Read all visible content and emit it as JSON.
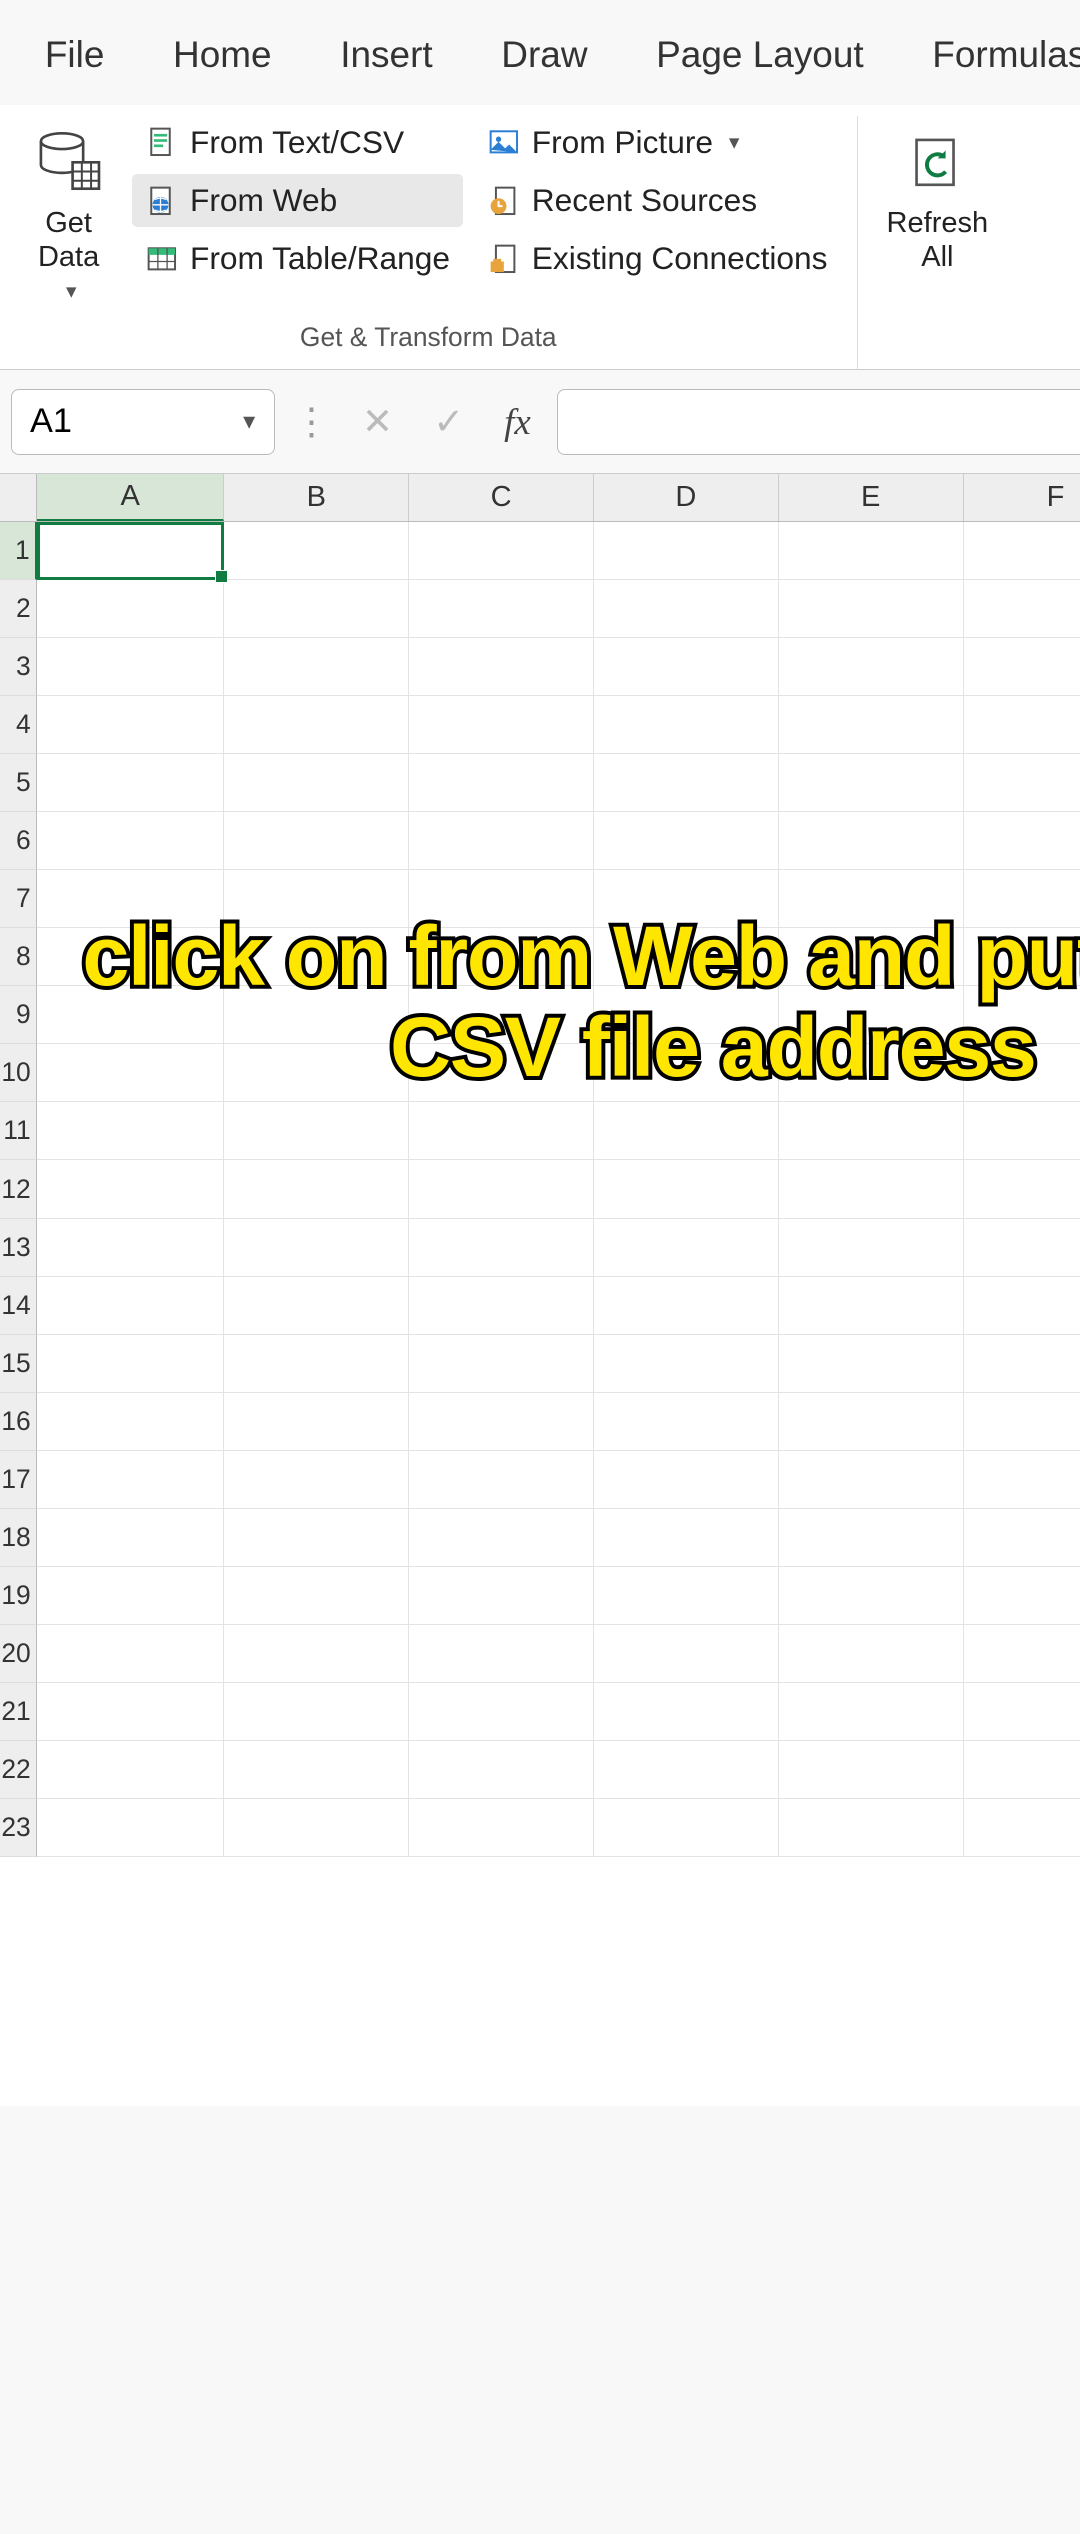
{
  "tabs": {
    "file": "File",
    "home": "Home",
    "insert": "Insert",
    "draw": "Draw",
    "page_layout": "Page Layout",
    "formulas": "Formulas"
  },
  "ribbon": {
    "get_data": "Get\nData",
    "from_text_csv": "From Text/CSV",
    "from_web": "From Web",
    "from_table_range": "From Table/Range",
    "from_picture": "From Picture",
    "recent_sources": "Recent Sources",
    "existing_connections": "Existing Connections",
    "refresh_all": "Refresh\nAll",
    "group_label": "Get & Transform Data"
  },
  "formula_bar": {
    "name_box": "A1",
    "fx": "fx",
    "formula_value": ""
  },
  "columns": [
    "A",
    "B",
    "C",
    "D",
    "E",
    "F"
  ],
  "rows": [
    "1",
    "2",
    "3",
    "4",
    "5",
    "6",
    "7",
    "8",
    "9",
    "10",
    "11",
    "12",
    "13",
    "14",
    "15",
    "16",
    "17",
    "18",
    "19",
    "20",
    "21",
    "22",
    "23"
  ],
  "selected_cell": "A1",
  "overlay_text": "click on from Web and put in the CSV file address",
  "colors": {
    "accent": "#107c41",
    "caption_fill": "#ffe600",
    "caption_stroke": "#000000"
  }
}
